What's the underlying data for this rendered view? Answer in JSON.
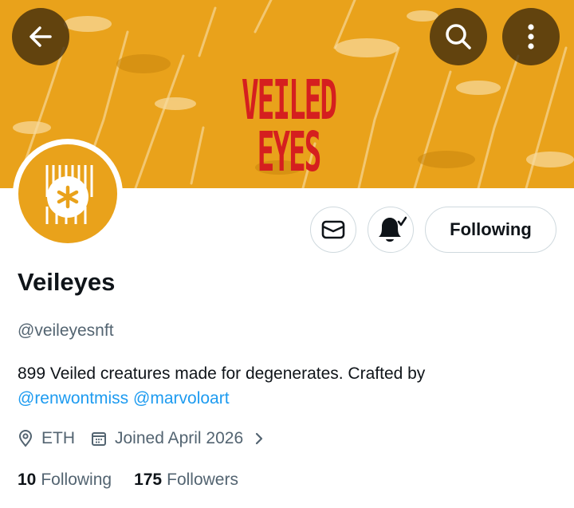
{
  "banner": {
    "title": "VEILED EYES"
  },
  "header": {
    "back_icon": "arrow-left-icon",
    "search_icon": "search-icon",
    "more_icon": "more-vertical-icon"
  },
  "profile": {
    "avatar_icon": "veiled-eyes-logo",
    "name": "Veileyes",
    "handle": "@veileyesnft",
    "bio_text": "899 Veiled creatures made for degenerates. Crafted by",
    "bio_mentions": [
      "@renwontmiss",
      "@marvoloart"
    ],
    "location": "ETH",
    "joined": "Joined April 2026"
  },
  "actions": {
    "message_icon": "mail-icon",
    "notify_icon": "bell-check-icon",
    "follow_label": "Following"
  },
  "stats": {
    "following_count": "10",
    "following_label": "Following",
    "followers_count": "175",
    "followers_label": "Followers"
  },
  "colors": {
    "banner": "#e9a21b",
    "banner_text": "#d51f1f",
    "mention": "#1d9bf0",
    "muted": "#536471"
  }
}
